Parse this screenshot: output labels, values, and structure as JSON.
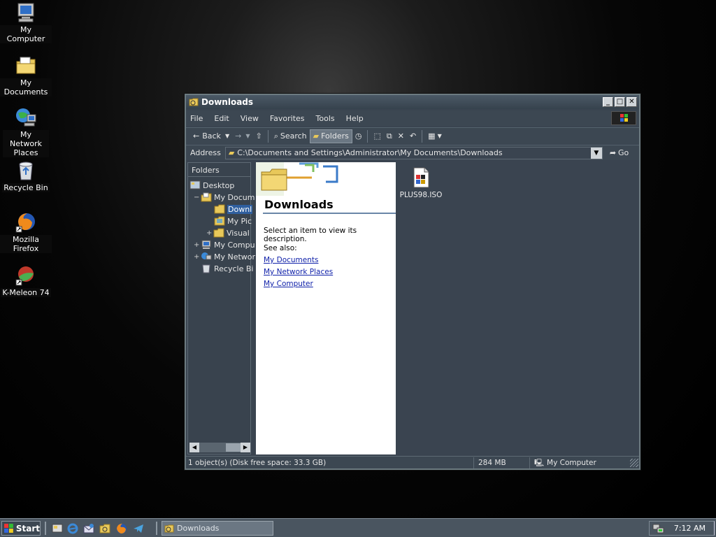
{
  "desktop": {
    "icons": [
      {
        "label": "My Computer",
        "icon": "computer-icon"
      },
      {
        "label": "My Documents",
        "icon": "documents-folder-icon"
      },
      {
        "label": "My Network Places",
        "icon": "network-places-icon"
      },
      {
        "label": "Recycle Bin",
        "icon": "recycle-bin-icon"
      },
      {
        "label": "Mozilla Firefox",
        "icon": "firefox-icon"
      },
      {
        "label": "K-Meleon 74",
        "icon": "k-meleon-icon"
      }
    ]
  },
  "window": {
    "title": "Downloads",
    "menu": [
      "File",
      "Edit",
      "View",
      "Favorites",
      "Tools",
      "Help"
    ],
    "toolbar": {
      "back": "Back",
      "search": "Search",
      "folders": "Folders"
    },
    "address": {
      "label": "Address",
      "value": "C:\\Documents and Settings\\Administrator\\My Documents\\Downloads",
      "go": "Go"
    },
    "folders_pane": {
      "header": "Folders",
      "items": [
        {
          "label": "Desktop",
          "expander": ""
        },
        {
          "label": "My Docum",
          "expander": "−"
        },
        {
          "label": "Downl",
          "expander": ""
        },
        {
          "label": "My Pic",
          "expander": ""
        },
        {
          "label": "Visual",
          "expander": "+"
        },
        {
          "label": "My Compu",
          "expander": "+"
        },
        {
          "label": "My Networ",
          "expander": "+"
        },
        {
          "label": "Recycle Bi",
          "expander": ""
        }
      ]
    },
    "webview": {
      "heading": "Downloads",
      "description": "Select an item to view its description.",
      "see_also": "See also:",
      "links": [
        "My Documents",
        "My Network Places",
        "My Computer"
      ]
    },
    "files": [
      {
        "name": "PLUS98.ISO",
        "icon": "iso-file-icon"
      }
    ],
    "status": {
      "objects": "1 object(s) (Disk free space: 33.3 GB)",
      "size": "284 MB",
      "zone": "My Computer"
    }
  },
  "taskbar": {
    "start": "Start",
    "task": "Downloads",
    "clock": "7:12 AM"
  },
  "colors": {
    "window_bg": "#3a4450",
    "selection": "#2f5f9f",
    "link": "#1122aa"
  }
}
